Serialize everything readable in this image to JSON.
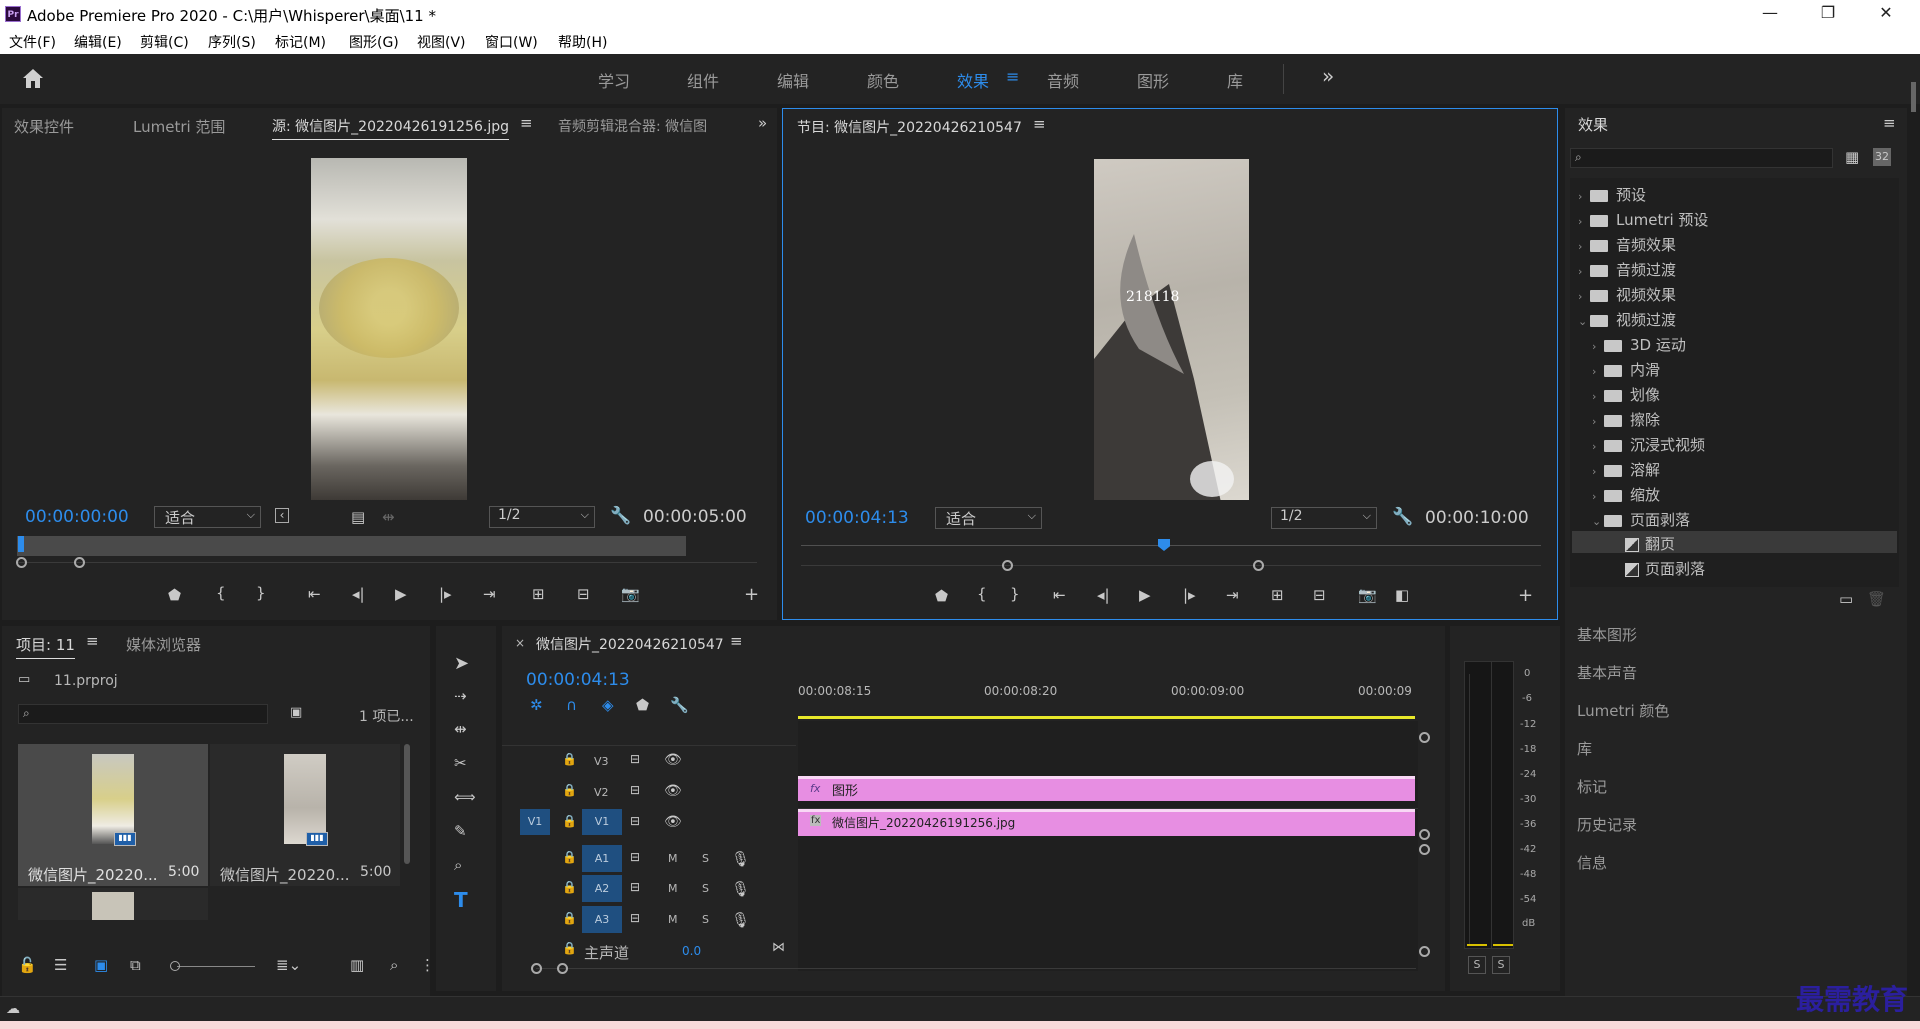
{
  "window": {
    "title": "Adobe Premiere Pro 2020 - C:\\用户\\Whisperer\\桌面\\11 *",
    "logo": "Pr",
    "min": "—",
    "max": "❐",
    "close": "✕"
  },
  "menu": [
    "文件(F)",
    "编辑(E)",
    "剪辑(C)",
    "序列(S)",
    "标记(M)",
    "图形(G)",
    "视图(V)",
    "窗口(W)",
    "帮助(H)"
  ],
  "workspaces": {
    "items": [
      "学习",
      "组件",
      "编辑",
      "颜色",
      "效果",
      "音频",
      "图形",
      "库"
    ],
    "active": "效果",
    "more": "»"
  },
  "source_panel": {
    "tabs": [
      "效果控件",
      "Lumetri 范围",
      "源: 微信图片_20220426191256.jpg",
      "音频剪辑混合器: 微信图"
    ],
    "timecode": "00:00:00:00",
    "fit": "适合",
    "resolution": "1/2",
    "duration": "00:00:05:00"
  },
  "program_panel": {
    "title": "节目: 微信图片_20220426210547",
    "timecode": "00:00:04:13",
    "fit": "适合",
    "resolution": "1/2",
    "duration": "00:00:10:00",
    "overlay_text": "218118"
  },
  "project_panel": {
    "tabs": [
      "项目: 11",
      "媒体浏览器"
    ],
    "file": "11.prproj",
    "count": "1 项已...",
    "items": [
      {
        "name": "微信图片_20220...",
        "dur": "5:00"
      },
      {
        "name": "微信图片_20220...",
        "dur": "5:00"
      }
    ]
  },
  "timeline": {
    "title": "微信图片_20220426210547",
    "timecode": "00:00:04:13",
    "ruler": [
      "00:00:08:15",
      "00:00:08:20",
      "00:00:09:00",
      "00:00:09"
    ],
    "tracks": {
      "v3": "V3",
      "v2": "V2",
      "v1": "V1",
      "a1": "A1",
      "a2": "A2",
      "a3": "A3",
      "src_v1": "V1",
      "master": "主声道",
      "master_val": "0.0"
    },
    "clips": {
      "v2": "图形",
      "v1": "微信图片_20220426191256.jpg"
    }
  },
  "meter": {
    "labels": [
      "0",
      "-6",
      "-12",
      "-18",
      "-24",
      "-30",
      "-36",
      "-42",
      "-48",
      "-54",
      "dB"
    ],
    "solo": [
      "S",
      "S"
    ]
  },
  "effects_panel": {
    "title": "效果",
    "items": [
      {
        "label": "预设",
        "level": 0,
        "open": false
      },
      {
        "label": "Lumetri 预设",
        "level": 0,
        "open": false
      },
      {
        "label": "音频效果",
        "level": 0,
        "open": false
      },
      {
        "label": "音频过渡",
        "level": 0,
        "open": false
      },
      {
        "label": "视频效果",
        "level": 0,
        "open": false
      },
      {
        "label": "视频过渡",
        "level": 0,
        "open": true
      },
      {
        "label": "3D 运动",
        "level": 1,
        "open": false
      },
      {
        "label": "内滑",
        "level": 1,
        "open": false
      },
      {
        "label": "划像",
        "level": 1,
        "open": false
      },
      {
        "label": "擦除",
        "level": 1,
        "open": false
      },
      {
        "label": "沉浸式视频",
        "level": 1,
        "open": false
      },
      {
        "label": "溶解",
        "level": 1,
        "open": false
      },
      {
        "label": "缩放",
        "level": 1,
        "open": false
      },
      {
        "label": "页面剥落",
        "level": 1,
        "open": true
      },
      {
        "label": "翻页",
        "level": 2,
        "open": false
      },
      {
        "label": "页面剥落",
        "level": 2,
        "open": false
      }
    ]
  },
  "right_panels": [
    "基本图形",
    "基本声音",
    "Lumetri 颜色",
    "库",
    "标记",
    "历史记录",
    "信息"
  ],
  "watermark": "最需教育",
  "colors": {
    "accent": "#2d8ceb",
    "clip": "#e78ee2",
    "playhead": "#2d8ceb"
  }
}
